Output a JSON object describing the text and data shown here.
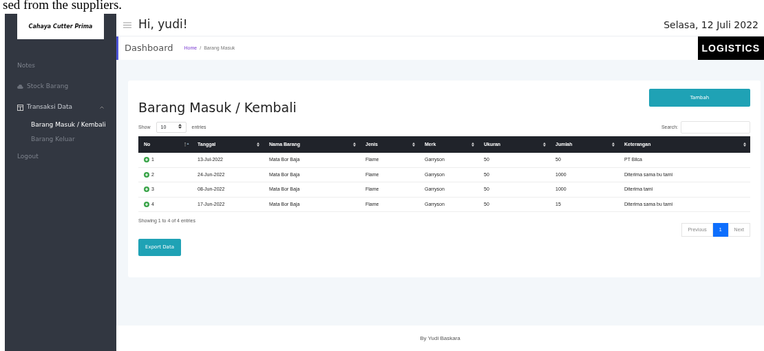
{
  "page_caption": "sed from the suppliers.",
  "sidebar": {
    "brand": "Cahaya Cutter Prima",
    "items": [
      {
        "label": "Notes",
        "selected": false
      },
      {
        "label": "Stock Barang",
        "selected": false
      },
      {
        "label": "Transaksi Data",
        "selected": false,
        "expanded": true,
        "children": [
          {
            "label": "Barang Masuk / Kembali",
            "selected": true
          },
          {
            "label": "Barang Keluar",
            "selected": false
          }
        ]
      },
      {
        "label": "Logout",
        "selected": false
      }
    ]
  },
  "header": {
    "greeting": "Hi, yudi!",
    "date": "Selasa, 12 Juli 2022"
  },
  "subheader": {
    "title": "Dashboard",
    "breadcrumb": [
      "Home",
      "Barang Masuk"
    ],
    "breadcrumb_separator": "/",
    "logo": "LOGISTICS"
  },
  "card": {
    "title": "Barang Masuk / Kembali",
    "add_button": "Tambah",
    "length": {
      "before": "Show",
      "value": "10",
      "after": "entries"
    },
    "search_label": "Search:",
    "table": {
      "columns": [
        {
          "label": "No",
          "sorted": true
        },
        {
          "label": "Tanggal",
          "sorted": false
        },
        {
          "label": "Nama Barang",
          "sorted": false
        },
        {
          "label": "Jenis",
          "sorted": false
        },
        {
          "label": "Merk",
          "sorted": false
        },
        {
          "label": "Ukuran",
          "sorted": false
        },
        {
          "label": "Jumlah",
          "sorted": false
        },
        {
          "label": "Keterangan",
          "sorted": false
        }
      ],
      "rows": [
        [
          "1",
          "13-Jul-2022",
          "Mata Bor Baja",
          "Flame",
          "Garryson",
          "50",
          "50",
          "PT Bilca"
        ],
        [
          "2",
          "24-Jun-2022",
          "Mata Bor Baja",
          "Flame",
          "Garryson",
          "50",
          "1000",
          "Diterima sama bu tami"
        ],
        [
          "3",
          "08-Jun-2022",
          "Mata Bor Baja",
          "Flame",
          "Garryson",
          "50",
          "1000",
          "Diterima tami"
        ],
        [
          "4",
          "17-Jun-2022",
          "Mata Bor Baja",
          "Flame",
          "Garryson",
          "50",
          "15",
          "Diterima sama bu tami"
        ]
      ]
    },
    "info": "Showing 1 to 4 of 4 entries",
    "pagination": [
      {
        "label": "Previous",
        "selected": false
      },
      {
        "label": "1",
        "selected": true
      },
      {
        "label": "Next",
        "selected": false
      }
    ],
    "export_button": "Export Data"
  },
  "footer": "By Yudi Baskara"
}
